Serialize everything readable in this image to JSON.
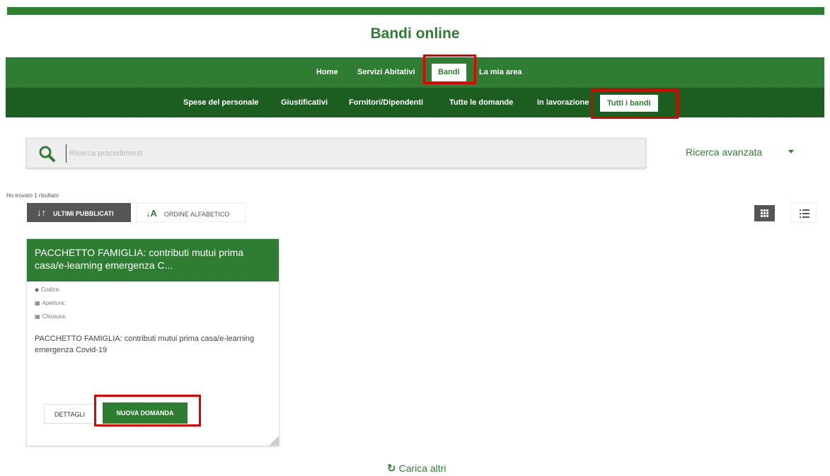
{
  "site": {
    "title": "Bandi online"
  },
  "nav_main": [
    {
      "label": "Home",
      "active": false
    },
    {
      "label": "Servizi Abitativi",
      "active": false
    },
    {
      "label": "Bandi",
      "active": true
    },
    {
      "label": "La mia area",
      "active": false
    }
  ],
  "nav_sub": [
    {
      "label": "Spese del personale",
      "active": false
    },
    {
      "label": "Giustificativi",
      "active": false
    },
    {
      "label": "Fornitori/Dipendenti",
      "active": false
    },
    {
      "label": "Tutte le domande",
      "active": false
    },
    {
      "label": "In lavorazione",
      "active": false
    },
    {
      "label": "Tutti i bandi",
      "active": true
    }
  ],
  "search": {
    "placeholder": "Ricerca procedimenti",
    "advanced_label": "Ricerca avanzata",
    "icon": "search-icon"
  },
  "results": {
    "count_text": "Ho trovato 1 risultato",
    "sort_latest": "ULTIMI PUBBLICATI",
    "sort_alpha": "ORDINE ALFABETICO",
    "sort_latest_icon": "↓↑",
    "sort_alpha_icon": "↓A",
    "view_modes": [
      "grid",
      "list"
    ],
    "active_view": "grid"
  },
  "card": {
    "title": "PACCHETTO FAMIGLIA: contributi mutui prima casa/e-learning emergenza C...",
    "code_label": "Codice:",
    "opening_label": "Apertura:",
    "closing_label": "Chiusura:",
    "description": "PACCHETTO FAMIGLIA: contributi mutui prima casa/e-learning emergenza Covid-19",
    "details_button": "DETTAGLI",
    "new_application_button": "NUOVA DOMANDA"
  },
  "load_more": {
    "label": "Carica altri",
    "icon": "↻"
  },
  "colors": {
    "primary_green": "#2e7d32",
    "dark_green": "#1b5e20",
    "highlight_red": "#e00000",
    "sort_active_bg": "#555555"
  }
}
